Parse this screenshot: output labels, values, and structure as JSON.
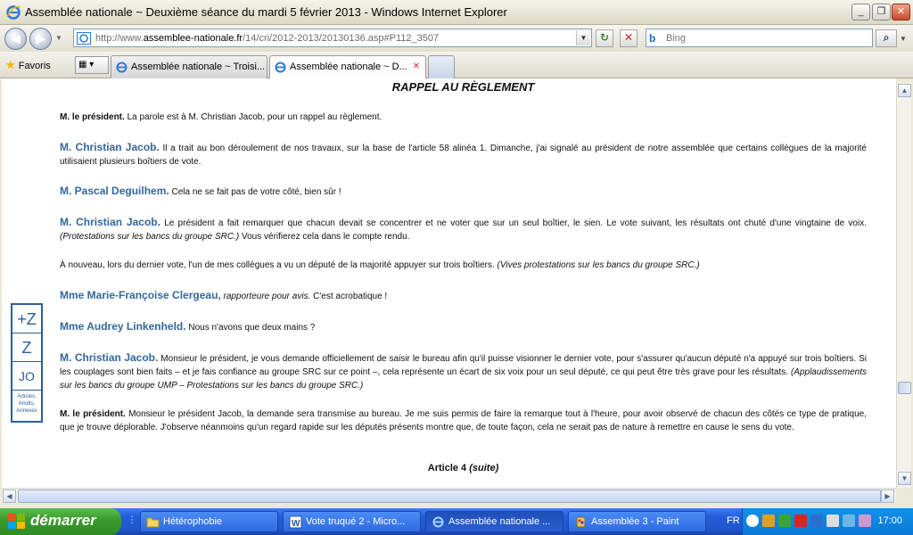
{
  "window": {
    "title": "Assemblée nationale ~ Deuxième séance du mardi 5 février 2013 - Windows Internet Explorer",
    "minimize": "_",
    "restore": "❐",
    "close": "✕"
  },
  "nav": {
    "back": "◀",
    "forward": "▶",
    "url_prefix": "http://www.",
    "url_domain": "assemblee-nationale.fr",
    "url_path": "/14/cri/2012-2013/20130136.asp#P112_3507",
    "search_placeholder": "Bing",
    "refresh": "↻",
    "stop": "✕",
    "search_btn": "⌕"
  },
  "favorites": {
    "label": "Favoris"
  },
  "tabs": [
    {
      "label": "Assemblée nationale ~ Troisi..."
    },
    {
      "label": "Assemblée nationale ~ D..."
    }
  ],
  "page": {
    "section_title": "RAPPEL AU RÈGLEMENT",
    "paragraphs": [
      {
        "speaker": "M. le président.",
        "text": " La parole est à M. Christian Jacob, pour un rappel au règlement."
      },
      {
        "speaker": "M. Christian Jacob.",
        "text": " Il a trait au bon déroulement de nos travaux, sur la base de l'article 58 alinéa 1. Dimanche, j'ai signalé au président de notre assemblée que certains collègues de la majorité utilisaient plusieurs boîtiers de vote."
      },
      {
        "speaker": "M. Pascal Deguilhem.",
        "text": " Cela ne se fait pas de votre côté, bien sûr !"
      },
      {
        "speaker": "M. Christian Jacob.",
        "text": " Le président a fait remarquer que chacun devait se concentrer et ne voter que sur un seul boîtier, le sien. Le vote suivant, les résultats ont chuté d'une vingtaine de voix. ",
        "stage": "(Protestations sur les bancs du groupe SRC.)",
        "text2": " Vous vérifierez cela dans le compte rendu."
      },
      {
        "text": "À nouveau, lors du dernier vote, l'un de mes collègues a vu un député de la majorité appuyer sur trois boîtiers. ",
        "stage": "(Vives protestations sur les bancs du groupe SRC.)"
      },
      {
        "speaker": "Mme Marie-Françoise Clergeau,",
        "role": " rapporteure pour avis.",
        "text": " C'est acrobatique !"
      },
      {
        "speaker": "Mme Audrey Linkenheld.",
        "text": " Nous n'avons que deux mains ?"
      },
      {
        "speaker": "M. Christian Jacob.",
        "text": " Monsieur le président, je vous demande officiellement de saisir le bureau afin qu'il puisse visionner le dernier vote, pour s'assurer qu'aucun député n'a appuyé sur trois boîtiers. Si les couplages sont bien faits – et je fais confiance au groupe SRC sur ce point –, cela représente un écart de six voix pour un seul député, ce qui peut être très grave pour les résultats. ",
        "stage": "(Applaudissements sur les bancs du groupe UMP – Protestations sur les bancs du groupe SRC.)"
      },
      {
        "speaker": "M. le président.",
        "text": " Monsieur le président Jacob, la demande sera transmise au bureau. Je me suis permis de faire la remarque tout à l'heure, pour avoir observé de chacun des côtés ce type de pratique, que je trouve déplorable. J'observe néanmoins qu'un regard rapide sur les députés présents montre que, de toute façon, cela ne serait pas de nature à remettre en cause le sens du vote."
      }
    ],
    "article": "Article 4 ",
    "article_suffix": "(suite)"
  },
  "side_widget": {
    "zoom_in": "+Z",
    "zoom_out": "Z",
    "jo": "JO",
    "annex": "Articles, Amdts, Annexes"
  },
  "taskbar": {
    "start": "démarrer",
    "tasks": [
      {
        "label": "Hétérophobie"
      },
      {
        "label": "Vote truqué 2 - Micro..."
      },
      {
        "label": "Assemblée nationale ..."
      },
      {
        "label": "Assemblée 3 - Paint"
      }
    ],
    "lang": "FR",
    "clock": "17:00"
  }
}
